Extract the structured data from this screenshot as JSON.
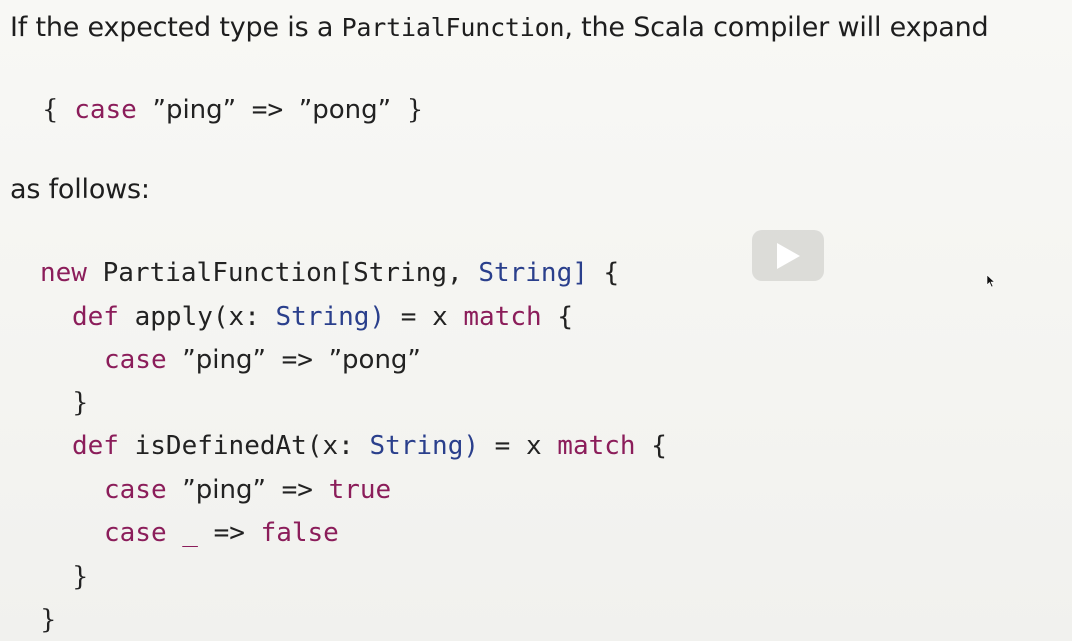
{
  "slide": {
    "intro": {
      "before": "If the expected type is a ",
      "type_name": "PartialFunction",
      "after": ", the Scala compiler will expand"
    },
    "example": {
      "open_brace": "{",
      "case_kw": "case",
      "pattern": "”ping”",
      "arrow": "=>",
      "result": "”pong”",
      "close_brace": "}"
    },
    "as_follows": "as follows:",
    "expansion": {
      "line1": {
        "kw": "new",
        "type": "PartialFunction[String,",
        "type2": "String]",
        "brace": "{"
      },
      "line2": {
        "kw": "def",
        "name": "apply(x:",
        "type": "String)",
        "eq": "=",
        "var": "x",
        "match_kw": "match",
        "brace": "{"
      },
      "line3": {
        "kw": "case",
        "pattern": "”ping”",
        "arrow": "=>",
        "result": "”pong”"
      },
      "line4": {
        "brace": "}"
      },
      "line5": {
        "kw": "def",
        "name": "isDefinedAt(x:",
        "type": "String)",
        "eq": "=",
        "var": "x",
        "match_kw": "match",
        "brace": "{"
      },
      "line6": {
        "kw": "case",
        "pattern": "”ping”",
        "arrow": "=>",
        "result": "true"
      },
      "line7": {
        "kw": "case",
        "pattern": "_",
        "arrow": "=>",
        "result": "false"
      },
      "line8": {
        "brace": "}"
      },
      "line9": {
        "brace": "}"
      }
    }
  },
  "video": {
    "play_icon": "play-icon"
  }
}
